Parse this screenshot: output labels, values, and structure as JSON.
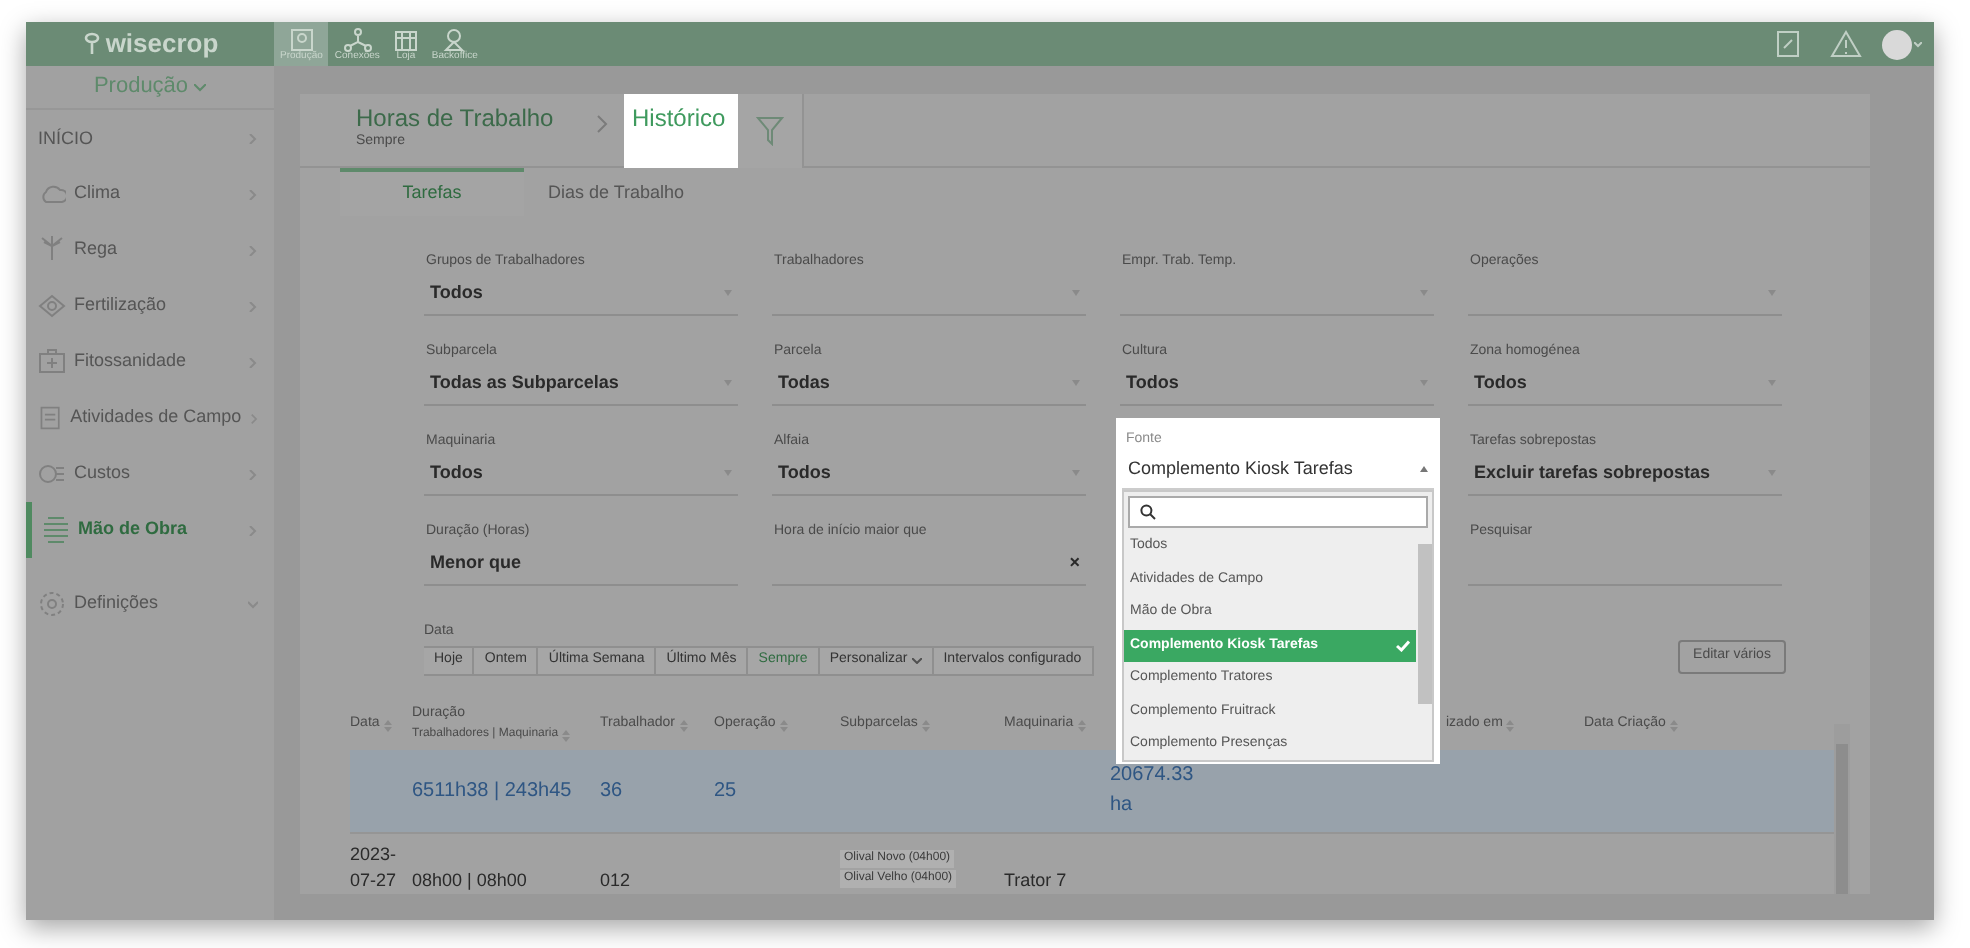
{
  "topbar": {
    "logo": "wisecrop",
    "apps": [
      {
        "label": "Produção",
        "selected": true
      },
      {
        "label": "Conexões",
        "selected": false
      },
      {
        "label": "Loja",
        "selected": false
      },
      {
        "label": "Backoffice",
        "selected": false
      }
    ]
  },
  "sidebar": {
    "module": "Produção",
    "items": [
      {
        "label": "INÍCIO",
        "selected": false,
        "expanded": false
      },
      {
        "label": "Clima",
        "selected": false,
        "expanded": false
      },
      {
        "label": "Rega",
        "selected": false,
        "expanded": false
      },
      {
        "label": "Fertilização",
        "selected": false,
        "expanded": false
      },
      {
        "label": "Fitossanidade",
        "selected": false,
        "expanded": false
      },
      {
        "label": "Atividades de Campo",
        "selected": false,
        "expanded": false
      },
      {
        "label": "Custos",
        "selected": false,
        "expanded": false
      },
      {
        "label": "Mão de Obra",
        "selected": true,
        "expanded": false
      },
      {
        "label": "Definições",
        "selected": false,
        "expanded": true
      }
    ]
  },
  "header": {
    "breadcrumb": "Horas de Trabalho",
    "current": "Histórico",
    "subtitle": "Sempre"
  },
  "tabs": [
    {
      "label": "Tarefas",
      "selected": true
    },
    {
      "label": "Dias de Trabalho",
      "selected": false
    }
  ],
  "filters": [
    {
      "label": "Grupos de Trabalhadores",
      "value": "Todos",
      "kind": "select"
    },
    {
      "label": "Trabalhadores",
      "kind": "select"
    },
    {
      "label": "Empr. Trab. Temp.",
      "kind": "select"
    },
    {
      "label": "Operações",
      "kind": "select"
    },
    {
      "label": "Subparcela",
      "value": "Todas as Subparcelas",
      "kind": "select"
    },
    {
      "label": "Parcela",
      "value": "Todas",
      "kind": "select"
    },
    {
      "label": "Cultura",
      "value": "Todos",
      "kind": "select"
    },
    {
      "label": "Zona homogénea",
      "value": "Todos",
      "kind": "select"
    },
    {
      "label": "Maquinaria",
      "value": "Todos",
      "kind": "select"
    },
    {
      "label": "Alfaia",
      "value": "Todos",
      "kind": "select"
    },
    {
      "label": "Fonte",
      "value": "Complemento Kiosk Tarefas",
      "kind": "open"
    },
    {
      "label": "Tarefas sobrepostas",
      "value": "Excluir tarefas sobrepostas",
      "kind": "select"
    },
    {
      "label": "Duração (Horas)",
      "value": "Menor que",
      "kind": "text"
    },
    {
      "label": "Hora de início maior que",
      "clear_label": "×",
      "kind": "clear"
    },
    {
      "kind": "covered"
    },
    {
      "label": "Pesquisar",
      "kind": "text"
    }
  ],
  "dropdown": {
    "options": [
      {
        "label": "Todos",
        "selected": false
      },
      {
        "label": "Atividades de Campo",
        "selected": false
      },
      {
        "label": "Mão de Obra",
        "selected": false
      },
      {
        "label": "Complemento Kiosk Tarefas",
        "selected": true
      },
      {
        "label": "Complemento Tratores",
        "selected": false
      },
      {
        "label": "Complemento Fruitrack",
        "selected": false
      },
      {
        "label": "Complemento Presenças",
        "selected": false
      }
    ]
  },
  "date": {
    "label": "Data",
    "options": [
      {
        "label": "Hoje",
        "selected": false
      },
      {
        "label": "Ontem",
        "selected": false
      },
      {
        "label": "Última Semana",
        "selected": false
      },
      {
        "label": "Último Mês",
        "selected": false
      },
      {
        "label": "Sempre",
        "selected": true
      },
      {
        "label": "Personalizar",
        "selected": false,
        "kind": "menu"
      },
      {
        "label": "Intervalos configurado",
        "selected": false
      }
    ]
  },
  "edit_button": "Editar vários",
  "table": {
    "columns": [
      {
        "label": "Data"
      },
      {
        "label": "Duração",
        "sublabel": "Trabalhadores | Maquinaria"
      },
      {
        "label": "Trabalhador"
      },
      {
        "label": "Operação"
      },
      {
        "label": "Subparcelas"
      },
      {
        "label": "Maquinaria"
      },
      {},
      {
        "label": "izado em"
      },
      {
        "label": "Data Criação"
      }
    ],
    "summary": {
      "duration": "6511h38 | 243h45",
      "workers": "36",
      "operations": "25",
      "column_7": "20674.33 ha"
    },
    "rows": [
      {
        "date": [
          "2023-",
          "07-27"
        ],
        "duration": "08h00 | 08h00",
        "worker": "012",
        "subparcels": [
          "Olival Novo (04h00)",
          "Olival Velho (04h00)"
        ],
        "machinery": "Trator 7"
      }
    ]
  }
}
